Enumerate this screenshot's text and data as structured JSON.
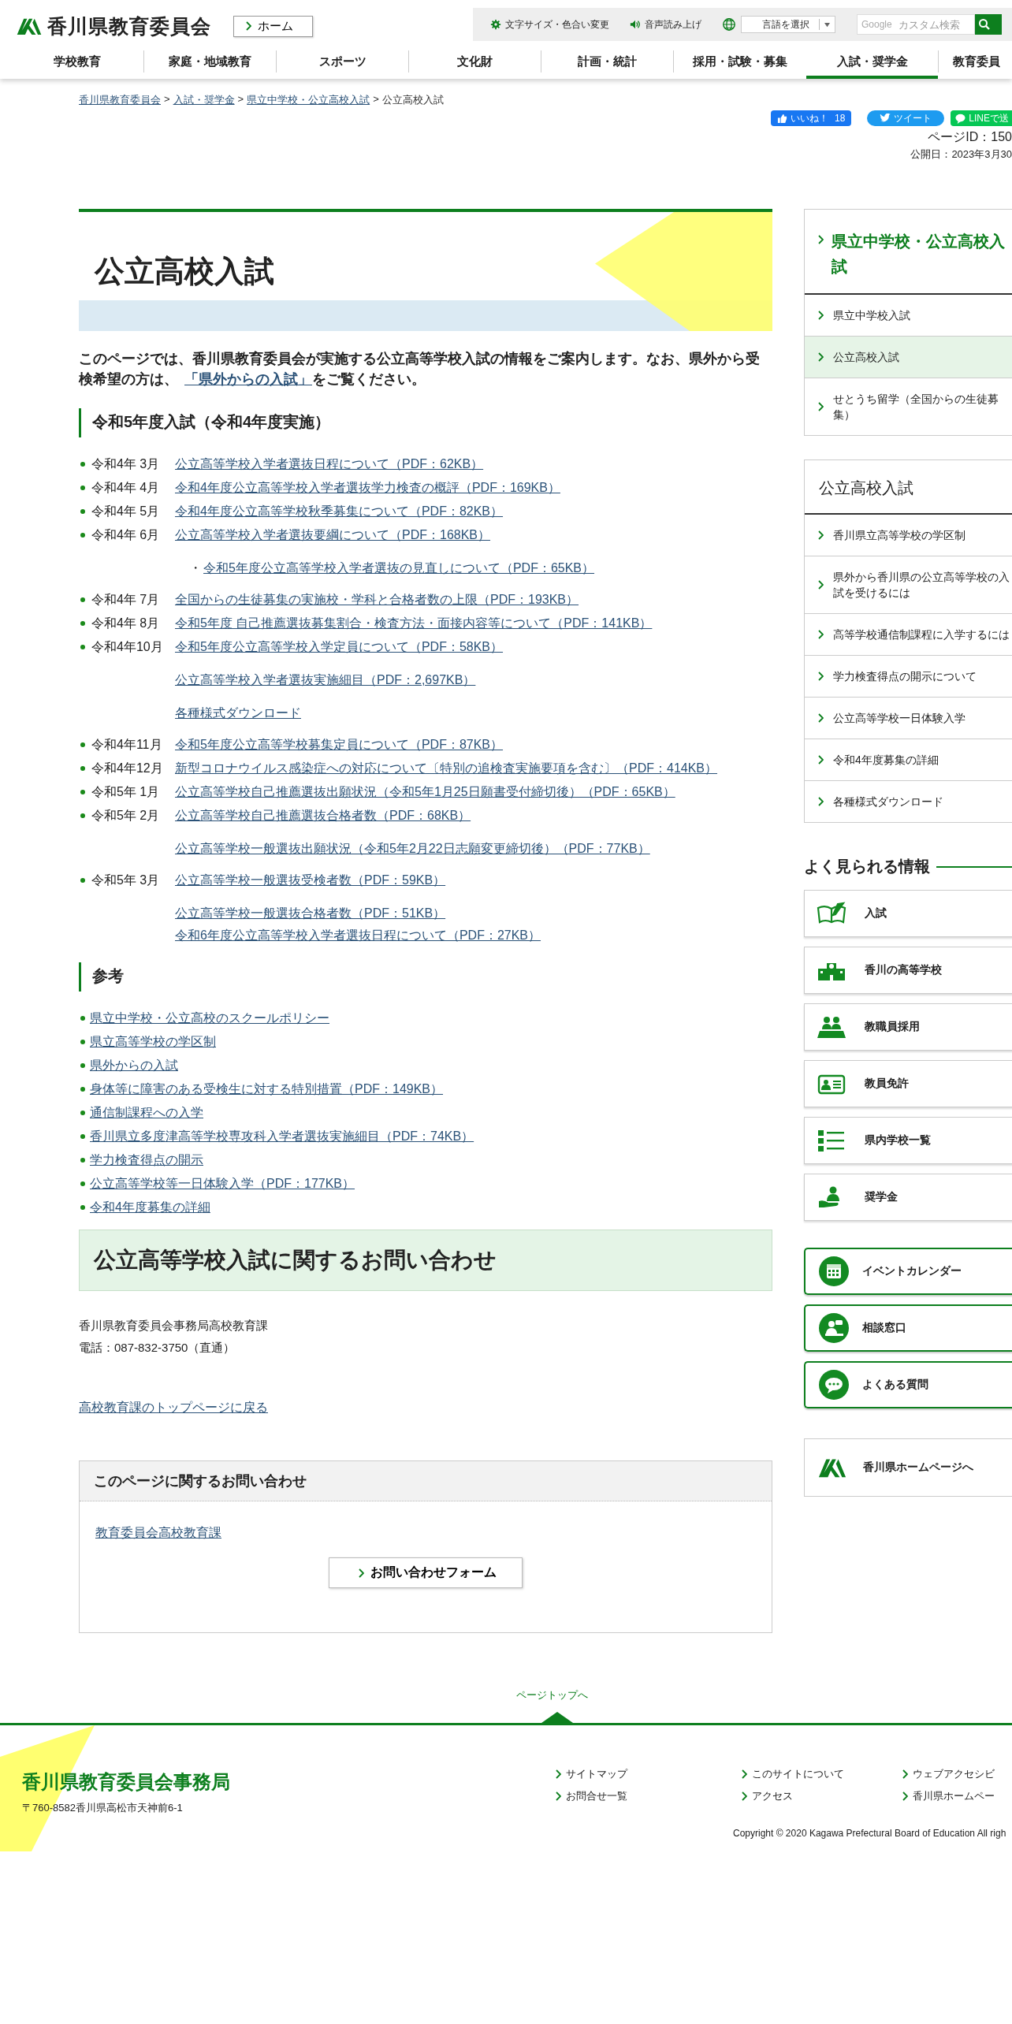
{
  "header": {
    "logo_text": "香川県教育委員会",
    "home_button": "ホーム",
    "tools": [
      "文字サイズ・色合い変更",
      "音声読み上げ"
    ],
    "language_select": "言語を選択",
    "search": {
      "brand": "Google",
      "placeholder": "カスタム検索"
    }
  },
  "nav": [
    {
      "label": "学校教育",
      "selected": false
    },
    {
      "label": "家庭・地域教育",
      "selected": false
    },
    {
      "label": "スポーツ",
      "selected": false
    },
    {
      "label": "文化財",
      "selected": false
    },
    {
      "label": "計画・統計",
      "selected": false
    },
    {
      "label": "採用・試験・募集",
      "selected": false
    },
    {
      "label": "入試・奨学金",
      "selected": true
    },
    {
      "label": "教育委員",
      "selected": false
    }
  ],
  "breadcrumb": [
    {
      "label": "香川県教育委員会",
      "link": true
    },
    {
      "label": "入試・奨学金",
      "link": true
    },
    {
      "label": "県立中学校・公立高校入試",
      "link": true
    },
    {
      "label": "公立高校入試",
      "link": false
    }
  ],
  "breadcrumb_separator": ">",
  "social": {
    "like": "いいね！",
    "like_count": "18",
    "tweet": "ツイート",
    "line": "LINEで送"
  },
  "page_id": "ページID：150",
  "published": "公開日：2023年3月30",
  "title": "公立高校入試",
  "intro": {
    "before": "このページでは、香川県教育委員会が実施する公立高等学校入試の情報をご案内します。なお、県外から受検希望の方は、",
    "link": "「県外からの入試」",
    "after": "をご覧ください。"
  },
  "schedule": {
    "heading": "令和5年度入試（令和4年度実施）",
    "rows": [
      {
        "kind": "dated",
        "date": "令和4年 3月",
        "link": "公立高等学校入学者選抜日程について（PDF：62KB）"
      },
      {
        "kind": "dated",
        "date": "令和4年 4月",
        "link": "令和4年度公立高等学校入学者選抜学力検査の概評（PDF：169KB）"
      },
      {
        "kind": "dated",
        "date": "令和4年 5月",
        "link": "令和4年度公立高等学校秋季募集について（PDF：82KB）"
      },
      {
        "kind": "dated",
        "date": "令和4年 6月",
        "link": "公立高等学校入学者選抜要綱について（PDF：168KB）"
      },
      {
        "kind": "sub",
        "marker": "・",
        "link": "令和5年度公立高等学校入学者選抜の見直しについて（PDF：65KB）"
      },
      {
        "kind": "dated",
        "date": "令和4年 7月",
        "link": "全国からの生徒募集の実施校・学科と合格者数の上限（PDF：193KB）"
      },
      {
        "kind": "dated",
        "date": "令和4年 8月",
        "link": "令和5年度 自己推薦選抜募集割合・検査方法・面接内容等について（PDF：141KB）"
      },
      {
        "kind": "dated",
        "date": "令和4年10月",
        "link": "令和5年度公立高等学校入学定員について（PDF：58KB）"
      },
      {
        "kind": "cont",
        "link": "公立高等学校入学者選抜実施細目（PDF：2,697KB）"
      },
      {
        "kind": "cont",
        "link": "各種様式ダウンロード"
      },
      {
        "kind": "dated",
        "date": "令和4年11月",
        "link": "令和5年度公立高等学校募集定員について（PDF：87KB）"
      },
      {
        "kind": "dated",
        "date": "令和4年12月",
        "link": "新型コロナウイルス感染症への対応について〔特別の追検査実施要項を含む〕（PDF：414KB）"
      },
      {
        "kind": "dated",
        "date": "令和5年 1月",
        "link": "公立高等学校自己推薦選抜出願状況（令和5年1月25日願書受付締切後）（PDF：65KB）"
      },
      {
        "kind": "dated",
        "date": "令和5年 2月",
        "link": "公立高等学校自己推薦選抜合格者数（PDF：68KB）"
      },
      {
        "kind": "cont",
        "link": "公立高等学校一般選抜出願状況（令和5年2月22日志願変更締切後）（PDF：77KB）"
      },
      {
        "kind": "dated",
        "date": "令和5年 3月",
        "link": "公立高等学校一般選抜受検者数（PDF：59KB）"
      },
      {
        "kind": "cont",
        "link": "公立高等学校一般選抜合格者数（PDF：51KB）"
      },
      {
        "kind": "tight",
        "link": "令和6年度公立高等学校入学者選抜日程について（PDF：27KB）"
      }
    ]
  },
  "references": {
    "heading": "参考",
    "links": [
      "県立中学校・公立高校のスクールポリシー",
      "県立高等学校の学区制",
      "県外からの入試",
      "身体等に障害のある受検生に対する特別措置（PDF：149KB）",
      "通信制課程への入学",
      "香川県立多度津高等学校専攻科入学者選抜実施細目（PDF：74KB）",
      "学力検査得点の開示",
      "公立高等学校等一日体験入学（PDF：177KB）",
      "令和4年度募集の詳細"
    ]
  },
  "contact": {
    "heading": "公立高等学校入試に関するお問い合わせ",
    "lines": [
      "香川県教育委員会事務局高校教育課",
      "電話：087-832-3750（直通）"
    ],
    "back_link": "高校教育課のトップページに戻る"
  },
  "inquiry": {
    "title": "このページに関するお問い合わせ",
    "department": "教育委員会高校教育課",
    "form_button": "お問い合わせフォーム"
  },
  "sidebar": {
    "menu": {
      "title": "県立中学校・公立高校入試",
      "items": [
        {
          "label": "県立中学校入試",
          "selected": false
        },
        {
          "label": "公立高校入試",
          "selected": true
        },
        {
          "label": "せとうち留学（全国からの生徒募集）",
          "selected": false
        }
      ]
    },
    "submenu": {
      "title": "公立高校入試",
      "items": [
        "香川県立高等学校の学区制",
        "県外から香川県の公立高等学校の入試を受けるには",
        "高等学校通信制課程に入学するには",
        "学力検査得点の開示について",
        "公立高等学校一日体験入学",
        "令和4年度募集の詳細",
        "各種様式ダウンロード"
      ]
    },
    "popular": {
      "heading": "よく見られる情報",
      "items": [
        "入試",
        "香川の高等学校",
        "教職員採用",
        "教員免許",
        "県内学校一覧",
        "奨学金"
      ]
    },
    "services": [
      "イベントカレンダー",
      "相談窓口",
      "よくある質問"
    ],
    "home_link": "香川県ホームページへ"
  },
  "footer": {
    "page_top": "ページトップへ",
    "org": "香川県教育委員会事務局",
    "address": "〒760-8582香川県高松市天神前6-1",
    "links": [
      "サイトマップ",
      "お問合せ一覧",
      "このサイトについて",
      "アクセス",
      "ウェブアクセシビ",
      "香川県ホームペー"
    ],
    "copyright": "Copyright © 2020 Kagawa Prefectural Board of Education All righ"
  }
}
